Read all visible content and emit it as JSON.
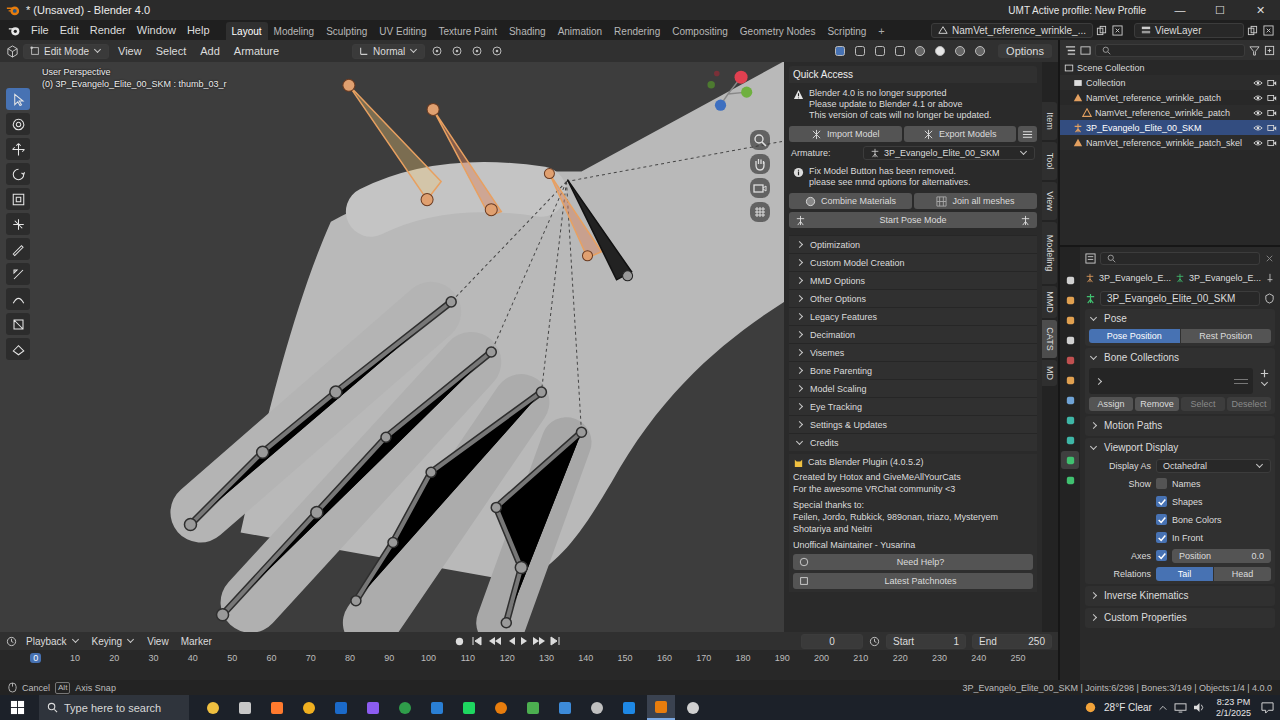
{
  "window": {
    "title": "* (Unsaved) - Blender 4.0",
    "profile": "UMT Active profile: New Profile",
    "controls": [
      "—",
      "☐",
      "✕"
    ]
  },
  "menus": [
    "File",
    "Edit",
    "Render",
    "Window",
    "Help"
  ],
  "workspaces": [
    {
      "label": "Layout",
      "selected": true
    },
    {
      "label": "Modeling",
      "selected": false
    },
    {
      "label": "Sculpting",
      "selected": false
    },
    {
      "label": "UV Editing",
      "selected": false
    },
    {
      "label": "Texture Paint",
      "selected": false
    },
    {
      "label": "Shading",
      "selected": false
    },
    {
      "label": "Animation",
      "selected": false
    },
    {
      "label": "Rendering",
      "selected": false
    },
    {
      "label": "Compositing",
      "selected": false
    },
    {
      "label": "Geometry Nodes",
      "selected": false
    },
    {
      "label": "Scripting",
      "selected": false
    }
  ],
  "add_workspace": "+",
  "scene": "NamVet_reference_wrinkle_...",
  "view_layer": "ViewLayer",
  "viewport": {
    "mode": "Edit Mode",
    "menus": [
      "View",
      "Select",
      "Add",
      "Armature"
    ],
    "orientation": "Normal",
    "options": "Options",
    "perspective": "User Perspective",
    "active_bone": "(0) 3P_Evangelo_Elite_00_SKM : thumb_03_r"
  },
  "tools": [
    {
      "selected": true
    },
    {
      "selected": false
    },
    {
      "selected": false
    },
    {
      "selected": false
    },
    {
      "selected": false
    },
    {
      "selected": false
    },
    {
      "selected": false
    },
    {
      "selected": false
    },
    {
      "selected": false
    },
    {
      "selected": false
    },
    {
      "selected": false
    }
  ],
  "sidebar_tabs": [
    {
      "label": "Item",
      "selected": false
    },
    {
      "label": "Tool",
      "selected": false
    },
    {
      "label": "View",
      "selected": false
    },
    {
      "label": "Modeling",
      "selected": false
    },
    {
      "label": "MMD",
      "selected": false
    },
    {
      "label": "CATS",
      "selected": true
    },
    {
      "label": "MD",
      "selected": false
    }
  ],
  "cats": {
    "title": "Quick Access",
    "warning": [
      "Blender 4.0 is no longer supported",
      "Please update to Blender 4.1 or above",
      "This version of cats will no longer be updated."
    ],
    "import": "Import Model",
    "export": "Export Models",
    "armature_label": "Armature:",
    "armature": "3P_Evangelo_Elite_00_SKM",
    "info": [
      "Fix Model Button has been removed.",
      "please see mmd options for alternatives."
    ],
    "combine": "Combine Materials",
    "join": "Join all meshes",
    "pose": "Start Pose Mode",
    "sections": [
      {
        "label": "Optimization",
        "expanded": false
      },
      {
        "label": "Custom Model Creation",
        "expanded": false
      },
      {
        "label": "MMD Options",
        "expanded": false
      },
      {
        "label": "Other Options",
        "expanded": false
      },
      {
        "label": "Legacy Features",
        "expanded": false
      },
      {
        "label": "Decimation",
        "expanded": false
      },
      {
        "label": "Visemes",
        "expanded": false
      },
      {
        "label": "Bone Parenting",
        "expanded": false
      },
      {
        "label": "Model Scaling",
        "expanded": false
      },
      {
        "label": "Eye Tracking",
        "expanded": false
      },
      {
        "label": "Settings & Updates",
        "expanded": false
      },
      {
        "label": "Credits",
        "expanded": true
      }
    ],
    "credits": {
      "version": "Cats Blender Plugin (4.0.5.2)",
      "lines": [
        "Created by Hotox and GiveMeAllYourCats",
        "For the awesome VRChat community <3"
      ],
      "thanks_title": "Special thanks to:",
      "thanks": [
        "Feilen, Jordo, Rubkick, 989onan, triazo, Mysteryem",
        "Shotariya and Neitri"
      ],
      "maintainer": "Unoffical Maintainer - Yusarina",
      "buttons": [
        "Need Help?",
        "Latest Patchnotes"
      ]
    }
  },
  "outliner": {
    "items": [
      {
        "label": "Scene Collection",
        "kind": "scene",
        "depth": 0,
        "selected": false
      },
      {
        "label": "Collection",
        "kind": "collection",
        "depth": 1,
        "selected": false
      },
      {
        "label": "NamVet_reference_wrinkle_patch",
        "kind": "object",
        "depth": 1,
        "selected": false
      },
      {
        "label": "NamVet_reference_wrinkle_patch",
        "kind": "mesh",
        "depth": 2,
        "selected": false
      },
      {
        "label": "3P_Evangelo_Elite_00_SKM",
        "kind": "armature",
        "depth": 1,
        "selected": true
      },
      {
        "label": "NamVet_reference_wrinkle_patch_skel",
        "kind": "object",
        "depth": 1,
        "selected": false
      }
    ]
  },
  "properties": {
    "tabs": [
      {
        "color": "#d0d0d0",
        "selected": false
      },
      {
        "color": "#e0a050",
        "selected": false
      },
      {
        "color": "#e0a050",
        "selected": false
      },
      {
        "color": "#d0d0d0",
        "selected": false
      },
      {
        "color": "#c05050",
        "selected": false
      },
      {
        "color": "#e0a050",
        "selected": false
      },
      {
        "color": "#6fa3d6",
        "selected": false
      },
      {
        "color": "#3eb6a6",
        "selected": false
      },
      {
        "color": "#3eb6a6",
        "selected": false
      },
      {
        "color": "#40c070",
        "selected": true
      },
      {
        "color": "#40c070",
        "selected": false
      }
    ],
    "breadcrumb": [
      "3P_Evangelo_E...",
      "3P_Evangelo_E..."
    ],
    "name": "3P_Evangelo_Elite_00_SKM",
    "pose": {
      "title": "Pose",
      "expanded": true,
      "options": [
        {
          "label": "Pose Position",
          "selected": true
        },
        {
          "label": "Rest Position",
          "selected": false
        }
      ]
    },
    "bone_collections": {
      "title": "Bone Collections",
      "expanded": true,
      "buttons": [
        {
          "label": "Assign",
          "disabled": false
        },
        {
          "label": "Remove",
          "disabled": false
        },
        {
          "label": "Select",
          "disabled": true
        },
        {
          "label": "Deselect",
          "disabled": true
        }
      ]
    },
    "motion_paths": {
      "title": "Motion Paths",
      "expanded": false
    },
    "viewport_display": {
      "title": "Viewport Display",
      "expanded": true,
      "display_as_label": "Display As",
      "display_as": "Octahedral",
      "show_label": "Show",
      "show": [
        {
          "label": "Names",
          "checked": false
        },
        {
          "label": "Shapes",
          "checked": true
        },
        {
          "label": "Bone Colors",
          "checked": true
        },
        {
          "label": "In Front",
          "checked": true
        }
      ],
      "axes_label": "Axes",
      "axes_checked": true,
      "position_label": "Position",
      "position": "0.0",
      "relations_label": "Relations",
      "relations": [
        {
          "label": "Tail",
          "selected": true
        },
        {
          "label": "Head",
          "selected": false
        }
      ]
    },
    "collapsed": [
      {
        "title": "Inverse Kinematics",
        "expanded": false
      },
      {
        "title": "Custom Properties",
        "expanded": false
      }
    ]
  },
  "timeline": {
    "menus": [
      "Playback",
      "Keying",
      "View",
      "Marker"
    ],
    "frame": "0",
    "start_label": "Start",
    "start": "1",
    "end_label": "End",
    "end": "250",
    "ticks": [
      "0",
      "10",
      "20",
      "30",
      "40",
      "50",
      "60",
      "70",
      "80",
      "90",
      "100",
      "110",
      "120",
      "130",
      "140",
      "150",
      "160",
      "170",
      "180",
      "190",
      "200",
      "210",
      "220",
      "230",
      "240",
      "250"
    ],
    "current": "0"
  },
  "status_bar": {
    "hints": [
      {
        "key": "",
        "label": "Cancel"
      },
      {
        "key": "Alt",
        "label": "Axis Snap"
      }
    ],
    "stats": "3P_Evangelo_Elite_00_SKM | Joints:6/298 | Bones:3/149 | Objects:1/4 | 4.0.0"
  },
  "taskbar": {
    "search": "Type here to search",
    "weather": "28°F Clear",
    "time": "8:23 PM",
    "date": "2/1/2025",
    "apps": [
      {
        "color": "#f0c040",
        "selected": false
      },
      {
        "color": "#c8c8c8",
        "selected": false
      },
      {
        "color": "#ff7a2e",
        "selected": false
      },
      {
        "color": "#f0b020",
        "selected": false
      },
      {
        "color": "#1b6ac9",
        "selected": false
      },
      {
        "color": "#8c5cf0",
        "selected": false
      },
      {
        "color": "#2f9d4a",
        "selected": false
      },
      {
        "color": "#2a7fd4",
        "selected": false
      },
      {
        "color": "#1ed760",
        "selected": false
      },
      {
        "color": "#e87d0d",
        "selected": false
      },
      {
        "color": "#4caf50",
        "selected": false
      },
      {
        "color": "#3d8bd9",
        "selected": false
      },
      {
        "color": "#c0c0c0",
        "selected": false
      },
      {
        "color": "#1e88e5",
        "selected": false
      },
      {
        "color": "#e87d0d",
        "selected": true
      },
      {
        "color": "#d0d0d0",
        "selected": false
      }
    ]
  }
}
